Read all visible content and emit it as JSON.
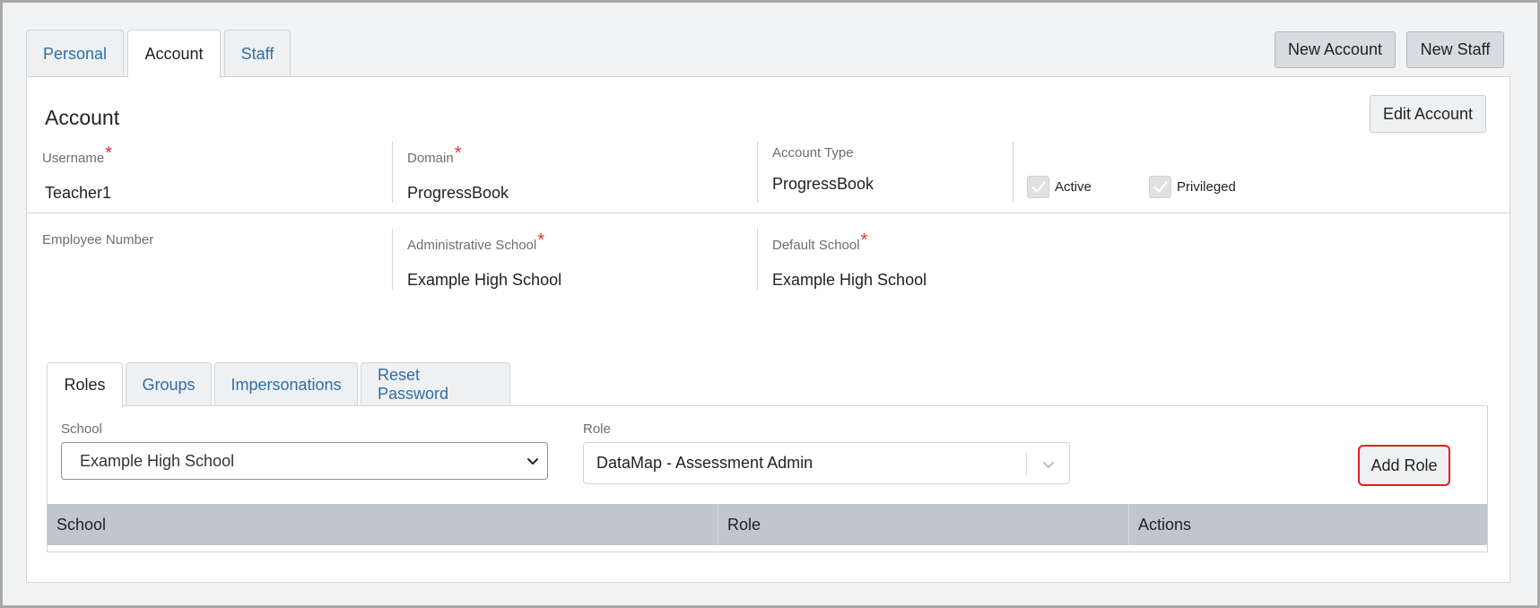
{
  "top_tabs": [
    {
      "label": "Personal",
      "active": false
    },
    {
      "label": "Account",
      "active": true
    },
    {
      "label": "Staff",
      "active": false
    }
  ],
  "header_buttons": {
    "new_account": "New Account",
    "new_staff": "New Staff"
  },
  "account": {
    "title": "Account",
    "edit_button": "Edit Account",
    "fields": {
      "username": {
        "label": "Username",
        "required": "*",
        "value": "Teacher1"
      },
      "domain": {
        "label": "Domain",
        "required": "*",
        "value": "ProgressBook"
      },
      "account_type": {
        "label": "Account Type",
        "value": "ProgressBook"
      },
      "employee_number": {
        "label": "Employee Number",
        "value": ""
      },
      "administrative_school": {
        "label": "Administrative School",
        "required": "*",
        "value": "Example High School"
      },
      "default_school": {
        "label": "Default School",
        "required": "*",
        "value": "Example High School"
      }
    },
    "checkboxes": {
      "active": {
        "label": "Active",
        "checked": true
      },
      "privileged": {
        "label": "Privileged",
        "checked": true
      }
    }
  },
  "inner_tabs": [
    {
      "label": "Roles",
      "active": true
    },
    {
      "label": "Groups",
      "active": false
    },
    {
      "label": "Impersonations",
      "active": false
    },
    {
      "label": "Reset Password",
      "active": false
    }
  ],
  "roles": {
    "school_label": "School",
    "school_selected": "Example High School",
    "role_label": "Role",
    "role_selected": "DataMap - Assessment Admin",
    "add_button": "Add Role",
    "table_columns": [
      "School",
      "Role",
      "Actions"
    ]
  },
  "colors": {
    "link": "#2f6fa7",
    "required": "#e2342c",
    "highlight": "#e02020",
    "table_header": "#bfc6cd"
  }
}
